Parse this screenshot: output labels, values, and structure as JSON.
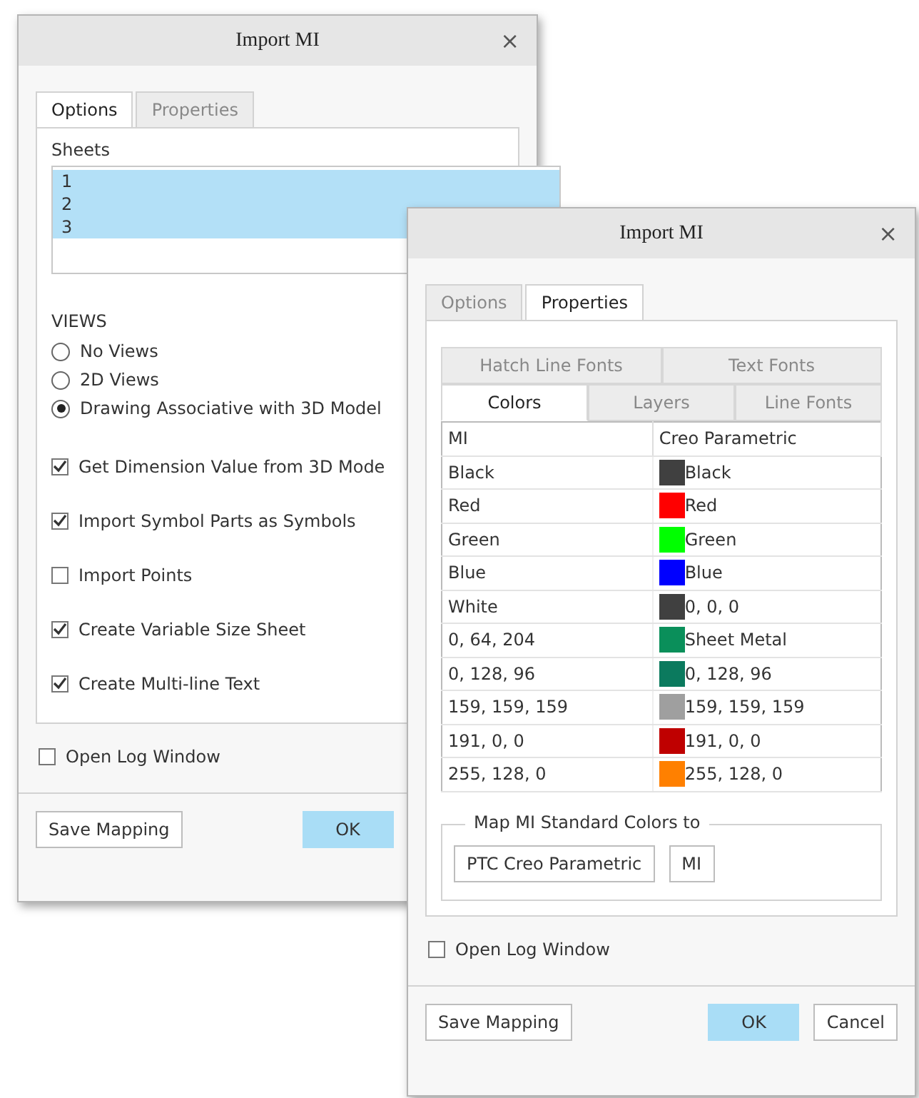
{
  "windows": [
    {
      "kind": "options",
      "title": "Import MI",
      "close": "×",
      "tabs": [
        {
          "label": "Options",
          "selected": true
        },
        {
          "label": "Properties",
          "selected": false
        }
      ],
      "sheets": {
        "label": "Sheets",
        "items": [
          {
            "label": "1",
            "selected": true
          },
          {
            "label": "2",
            "selected": true
          },
          {
            "label": "3",
            "selected": true
          }
        ]
      },
      "views": {
        "label": "VIEWS",
        "options": [
          {
            "label": "No Views",
            "selected": false
          },
          {
            "label": "2D Views",
            "selected": false
          },
          {
            "label": "Drawing Associative with 3D Model",
            "selected": true
          }
        ]
      },
      "checkboxes": [
        {
          "label": "Get Dimension Value from 3D Mode",
          "checked": true
        },
        {
          "label": "Import Symbol Parts as Symbols",
          "checked": true
        },
        {
          "label": "Import Points",
          "checked": false
        },
        {
          "label": "Create Variable Size Sheet",
          "checked": true
        },
        {
          "label": "Create Multi-line Text",
          "checked": true
        }
      ],
      "log": {
        "label": "Open Log Window",
        "checked": false
      },
      "buttons": [
        {
          "label": "Save Mapping",
          "kind": "default"
        },
        {
          "label": "OK",
          "kind": "primary"
        }
      ]
    },
    {
      "kind": "properties",
      "title": "Import MI",
      "close": "×",
      "tabs": [
        {
          "label": "Options",
          "selected": false
        },
        {
          "label": "Properties",
          "selected": true
        }
      ],
      "subtabs": [
        [
          {
            "label": "Hatch Line Fonts",
            "selected": false
          },
          {
            "label": "Text Fonts",
            "selected": false
          }
        ],
        [
          {
            "label": "Colors",
            "selected": true
          },
          {
            "label": "Layers",
            "selected": false
          },
          {
            "label": "Line Fonts",
            "selected": false
          }
        ]
      ],
      "table": {
        "columns": [
          "MI",
          "Creo Parametric"
        ],
        "rows": [
          {
            "mi": "Black",
            "creo": "Black",
            "color": "#404040"
          },
          {
            "mi": "Red",
            "creo": "Red",
            "color": "#ff0000"
          },
          {
            "mi": "Green",
            "creo": "Green",
            "color": "#00ff00"
          },
          {
            "mi": "Blue",
            "creo": "Blue",
            "color": "#0000ff"
          },
          {
            "mi": "White",
            "creo": "0, 0, 0",
            "color": "#404040"
          },
          {
            "mi": "0, 64, 204",
            "creo": "Sheet Metal",
            "color": "#0a8f5a"
          },
          {
            "mi": "0, 128, 96",
            "creo": "0, 128, 96",
            "color": "#0b7a5e"
          },
          {
            "mi": "159, 159, 159",
            "creo": "159, 159, 159",
            "color": "#9f9f9f"
          },
          {
            "mi": "191, 0, 0",
            "creo": "191, 0, 0",
            "color": "#bf0000"
          },
          {
            "mi": "255, 128, 0",
            "creo": "255, 128, 0",
            "color": "#ff8000"
          }
        ]
      },
      "map_group": {
        "title": "Map MI Standard Colors to",
        "buttons": [
          "PTC Creo Parametric",
          "MI"
        ]
      },
      "log": {
        "label": "Open Log Window",
        "checked": false
      },
      "buttons": [
        {
          "label": "Save Mapping",
          "kind": "default"
        },
        {
          "label": "OK",
          "kind": "primary"
        },
        {
          "label": "Cancel",
          "kind": "default"
        }
      ]
    }
  ]
}
